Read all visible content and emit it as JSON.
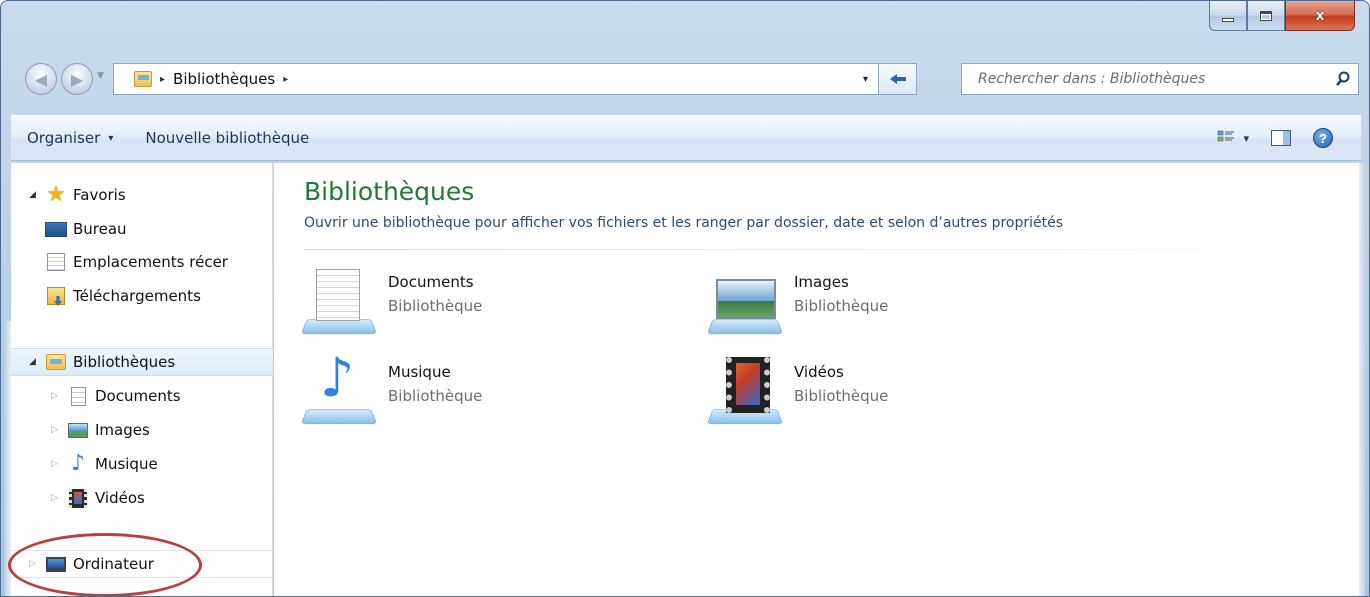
{
  "window": {
    "minimize_icon": "minimize-icon",
    "maximize_icon": "maximize-icon",
    "close_glyph": "x"
  },
  "address": {
    "path": [
      "Bibliothèques"
    ],
    "separator": "▸",
    "dropdown_glyph": "▾",
    "refresh_glyph": "⁴↪"
  },
  "search": {
    "placeholder": "Rechercher dans : Bibliothèques"
  },
  "toolbar": {
    "organize_label": "Organiser",
    "new_library_label": "Nouvelle bibliothèque",
    "caret": "▾",
    "help_glyph": "?"
  },
  "navpane": {
    "favorites_label": "Favoris",
    "favorites": [
      {
        "label": "Bureau",
        "icon": "desktop-icon"
      },
      {
        "label": "Emplacements récer",
        "icon": "recent-places-icon"
      },
      {
        "label": "Téléchargements",
        "icon": "downloads-icon"
      }
    ],
    "libraries_label": "Bibliothèques",
    "libraries": [
      {
        "label": "Documents",
        "icon": "document-icon"
      },
      {
        "label": "Images",
        "icon": "pictures-icon"
      },
      {
        "label": "Musique",
        "icon": "music-icon"
      },
      {
        "label": "Vidéos",
        "icon": "video-icon"
      }
    ],
    "computer_label": "Ordinateur",
    "expand_open": "◢",
    "expand_closed": "▷"
  },
  "content": {
    "title": "Bibliothèques",
    "description": "Ouvrir une bibliothèque pour afficher vos fichiers et les ranger par dossier, date et selon d’autres propriétés",
    "items": [
      {
        "name": "Documents",
        "type": "Bibliothèque",
        "icon": "documents-library-icon"
      },
      {
        "name": "Images",
        "type": "Bibliothèque",
        "icon": "pictures-library-icon"
      },
      {
        "name": "Musique",
        "type": "Bibliothèque",
        "icon": "music-library-icon"
      },
      {
        "name": "Vidéos",
        "type": "Bibliothèque",
        "icon": "videos-library-icon"
      }
    ]
  },
  "colors": {
    "title_green": "#1e7b34",
    "annotation_red": "#b8413f",
    "close_red": "#c4391a"
  }
}
